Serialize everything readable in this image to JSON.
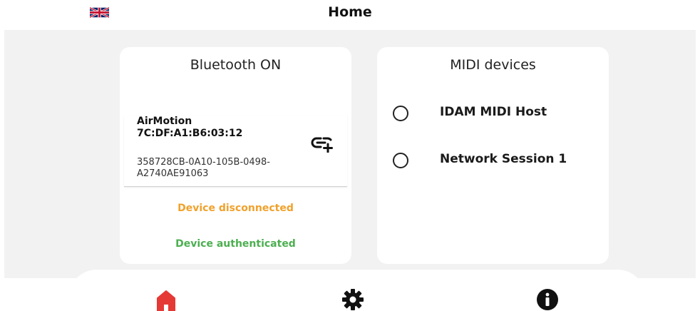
{
  "header": {
    "title": "Home",
    "flag_icon": "uk-flag-icon"
  },
  "bluetooth_card": {
    "title": "Bluetooth ON",
    "device": {
      "name": "AirMotion",
      "mac": "7C:DF:A1:B6:03:12",
      "uuid": "358728CB-0A10-105B-0498-A2740AE91063",
      "action_icon": "link-add-icon"
    },
    "status_disconnected": "Device disconnected",
    "status_authenticated": "Device authenticated",
    "colors": {
      "disconnected": "#f0a12b",
      "authenticated": "#4caf50"
    }
  },
  "midi_card": {
    "title": "MIDI devices",
    "items": [
      {
        "label": "IDAM MIDI Host",
        "selected": false
      },
      {
        "label": "Network Session 1",
        "selected": false
      }
    ]
  },
  "nav": {
    "items": [
      {
        "icon": "home-icon",
        "active": true,
        "color": "#e53935"
      },
      {
        "icon": "gear-icon",
        "active": false,
        "color": "#111111"
      },
      {
        "icon": "info-icon",
        "active": false,
        "color": "#111111"
      }
    ]
  }
}
